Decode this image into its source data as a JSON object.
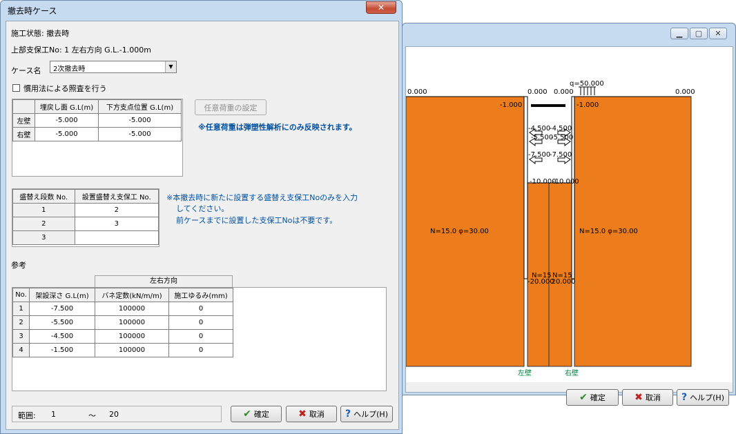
{
  "back_window": {
    "buttons": {
      "ok": "確定",
      "cancel": "取消",
      "help": "ヘルプ(H)"
    },
    "diagram": {
      "surcharge": "q=50.000",
      "levels": {
        "left_top": "0.000",
        "mid_left_top": "0.000",
        "mid_right_top": "0.000",
        "right_top": "0.000"
      },
      "strut_level_left": "-1.000",
      "strut_level_right": "-1.000",
      "temp_strut_1": "-4.500",
      "temp_strut_1r": "-4.500",
      "temp_strut_2": "-5.500",
      "temp_strut_2r": "-5.500",
      "temp_strut_3": "-7.500",
      "temp_strut_3r": "-7.500",
      "exc_bottom": "-10.000",
      "exc_bottom_r": "-10.000",
      "wall_bottom_left": "-20.000",
      "wall_bottom_right": "-20.000",
      "soil_left": "N=15.0 φ=30.00",
      "soil_right": "N=15.0 φ=30.00",
      "soil_inner_left": "N=15",
      "soil_inner_right": "N=15",
      "wall_left_label": "左壁",
      "wall_right_label": "右壁",
      "soil_color": "#ed7d1c"
    }
  },
  "dialog": {
    "title": "撤去時ケース",
    "close": "✕",
    "state_label": "施工状態: 撤去時",
    "support_label": "上部支保工No: 1    左右方向 G.L.-1.000m",
    "case_label": "ケース名",
    "case_value": "2次撤去時",
    "check_label": "慣用法による照査を行う",
    "wall_table": {
      "headers": [
        "",
        "埋戻し面 G.L(m)",
        "下方支点位置 G.L(m)"
      ],
      "rows": [
        {
          "name": "左壁",
          "fill": "-5.000",
          "support": "-5.000"
        },
        {
          "name": "右壁",
          "fill": "-5.000",
          "support": "-5.000"
        }
      ]
    },
    "load_button": "任意荷重の設定",
    "load_note": "※任意荷重は弾塑性解析にのみ反映されます。",
    "replace_table": {
      "headers": [
        "盛替え段数 No.",
        "設置盛替え支保工 No."
      ],
      "rows": [
        {
          "stage": "1",
          "support": "2"
        },
        {
          "stage": "2",
          "support": "3"
        },
        {
          "stage": "3",
          "support": ""
        }
      ]
    },
    "replace_note_1": "※本撤去時に新たに設置する盛替え支保工Noのみを入力",
    "replace_note_2": "してください。",
    "replace_note_3": "前ケースまでに設置した支保工Noは不要です。",
    "ref_label": "参考",
    "ref_table": {
      "group_header": "左右方向",
      "headers": [
        "No.",
        "架設深さ G.L(m)",
        "バネ定数(kN/m/m)",
        "施工ゆるみ(mm)"
      ],
      "rows": [
        {
          "no": "1",
          "depth": "-7.500",
          "spring": "100000",
          "slack": "0"
        },
        {
          "no": "2",
          "depth": "-5.500",
          "spring": "100000",
          "slack": "0"
        },
        {
          "no": "3",
          "depth": "-4.500",
          "spring": "100000",
          "slack": "0"
        },
        {
          "no": "4",
          "depth": "-1.500",
          "spring": "100000",
          "slack": "0"
        }
      ]
    },
    "range_label": "範囲:",
    "range_min": "1",
    "range_sep": "〜",
    "range_max": "20",
    "buttons": {
      "ok": "確定",
      "cancel": "取消",
      "help": "ヘルプ(H)"
    }
  }
}
